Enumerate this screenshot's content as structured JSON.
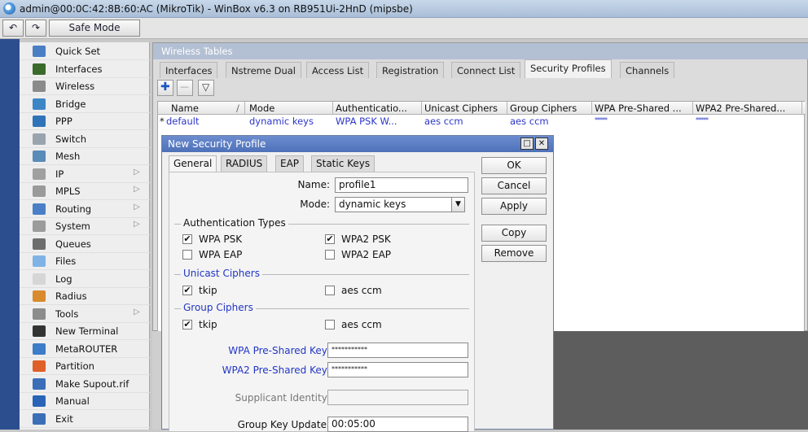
{
  "window": {
    "title": "admin@00:0C:42:8B:60:AC (MikroTik) - WinBox v6.3 on RB951Ui-2HnD (mipsbe)"
  },
  "toolbar": {
    "undo_glyph": "↶",
    "redo_glyph": "↷",
    "safe_mode_label": "Safe Mode"
  },
  "sidebar": {
    "items": [
      {
        "label": "Quick Set",
        "icon": "quick-set-icon",
        "color": "#4b7fc4",
        "sub": false
      },
      {
        "label": "Interfaces",
        "icon": "interfaces-icon",
        "color": "#3a6b2a",
        "sub": false
      },
      {
        "label": "Wireless",
        "icon": "wireless-icon",
        "color": "#8a8a8a",
        "sub": false
      },
      {
        "label": "Bridge",
        "icon": "bridge-icon",
        "color": "#3d86c6",
        "sub": false
      },
      {
        "label": "PPP",
        "icon": "ppp-icon",
        "color": "#2f73b8",
        "sub": false
      },
      {
        "label": "Switch",
        "icon": "switch-icon",
        "color": "#9aa4ad",
        "sub": false
      },
      {
        "label": "Mesh",
        "icon": "mesh-icon",
        "color": "#5a8ab8",
        "sub": false
      },
      {
        "label": "IP",
        "icon": "ip-icon",
        "color": "#a0a0a0",
        "sub": true
      },
      {
        "label": "MPLS",
        "icon": "mpls-icon",
        "color": "#9a9a9a",
        "sub": true
      },
      {
        "label": "Routing",
        "icon": "routing-icon",
        "color": "#4a7fc7",
        "sub": true
      },
      {
        "label": "System",
        "icon": "system-icon",
        "color": "#9b9b9b",
        "sub": true
      },
      {
        "label": "Queues",
        "icon": "queues-icon",
        "color": "#6d6d6d",
        "sub": false
      },
      {
        "label": "Files",
        "icon": "files-icon",
        "color": "#7fb3e6",
        "sub": false
      },
      {
        "label": "Log",
        "icon": "log-icon",
        "color": "#d6d6d6",
        "sub": false
      },
      {
        "label": "Radius",
        "icon": "radius-icon",
        "color": "#d98a2e",
        "sub": false
      },
      {
        "label": "Tools",
        "icon": "tools-icon",
        "color": "#8c8c8c",
        "sub": true
      },
      {
        "label": "New Terminal",
        "icon": "terminal-icon",
        "color": "#333333",
        "sub": false
      },
      {
        "label": "MetaROUTER",
        "icon": "metarouter-icon",
        "color": "#3d7cc8",
        "sub": false
      },
      {
        "label": "Partition",
        "icon": "partition-icon",
        "color": "#e0602a",
        "sub": false
      },
      {
        "label": "Make Supout.rif",
        "icon": "supout-icon",
        "color": "#3a6fb8",
        "sub": false
      },
      {
        "label": "Manual",
        "icon": "manual-icon",
        "color": "#2a64b8",
        "sub": false
      },
      {
        "label": "Exit",
        "icon": "exit-icon",
        "color": "#3a6fb8",
        "sub": false
      }
    ],
    "submenu_arrow": "▷"
  },
  "wireless_tables": {
    "title": "Wireless Tables",
    "tabs": [
      "Interfaces",
      "Nstreme Dual",
      "Access List",
      "Registration",
      "Connect List",
      "Security Profiles",
      "Channels"
    ],
    "active_tab": "Security Profiles",
    "add_glyph": "✚",
    "remove_glyph": "—",
    "filter_glyph": "▽",
    "columns": [
      "Name",
      "Mode",
      "Authenticatio...",
      "Unicast Ciphers",
      "Group Ciphers",
      "WPA Pre-Shared ...",
      "WPA2 Pre-Shared..."
    ],
    "sort_marker": "/",
    "rows": [
      {
        "marker": "*",
        "name": "default",
        "mode": "dynamic keys",
        "authentication": "WPA PSK W...",
        "unicast": "aes ccm",
        "group": "aes ccm",
        "wpa_key": "*****",
        "wpa2_key": "*****"
      }
    ]
  },
  "dialog": {
    "title": "New Security Profile",
    "restore_glyph": "□",
    "close_glyph": "✕",
    "tabs": [
      "General",
      "RADIUS",
      "EAP",
      "Static Keys"
    ],
    "active_tab": "General",
    "buttons": {
      "ok": "OK",
      "cancel": "Cancel",
      "apply": "Apply",
      "copy": "Copy",
      "remove": "Remove"
    },
    "name_label": "Name:",
    "name_value": "profile1",
    "mode_label": "Mode:",
    "mode_value": "dynamic keys",
    "dropdown_glyph": "▼",
    "auth_types_title": "Authentication Types",
    "auth_options": [
      {
        "label": "WPA PSK",
        "checked": true
      },
      {
        "label": "WPA2 PSK",
        "checked": true
      },
      {
        "label": "WPA EAP",
        "checked": false
      },
      {
        "label": "WPA2 EAP",
        "checked": false
      }
    ],
    "unicast_title": "Unicast Ciphers",
    "unicast_options": [
      {
        "label": "tkip",
        "checked": true
      },
      {
        "label": "aes ccm",
        "checked": false
      }
    ],
    "group_title": "Group Ciphers",
    "group_options": [
      {
        "label": "tkip",
        "checked": true
      },
      {
        "label": "aes ccm",
        "checked": false
      }
    ],
    "check_glyph": "✔",
    "wpa_key_label": "WPA Pre-Shared Key:",
    "wpa_key_value": "***********",
    "wpa2_key_label": "WPA2 Pre-Shared Key:",
    "wpa2_key_value": "***********",
    "supplicant_label": "Supplicant Identity:",
    "supplicant_value": "",
    "group_key_label": "Group Key Update:",
    "group_key_value": "00:05:00"
  },
  "colors": {
    "accent_blue": "#2236c4",
    "left_strip": "#2d4e8e"
  }
}
